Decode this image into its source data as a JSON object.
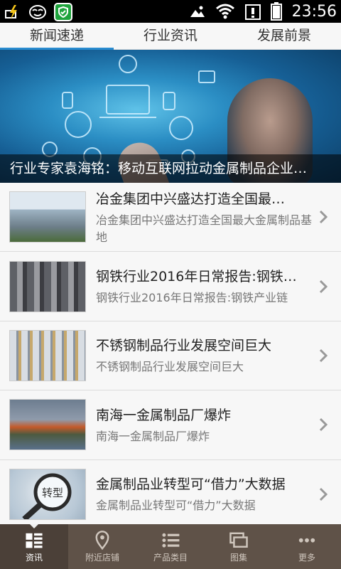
{
  "status_bar": {
    "time": "23:56",
    "icons": [
      "flash-icon",
      "face-icon",
      "shield-app-icon",
      "image-icon",
      "wifi-icon",
      "alert-icon",
      "battery-icon"
    ]
  },
  "tabs": [
    {
      "label": "新闻速递",
      "active": true
    },
    {
      "label": "行业资讯",
      "active": false
    },
    {
      "label": "发展前景",
      "active": false
    }
  ],
  "hero": {
    "caption": "行业专家袁海铭：移动互联网拉动金属制品企业…"
  },
  "news": [
    {
      "title": "冶金集团中兴盛达打造全国最…",
      "desc": "冶金集团中兴盛达打造全国最大金属制品基地"
    },
    {
      "title": "钢铁行业2016年日常报告:钢铁…",
      "desc": "钢铁行业2016年日常报告:钢铁产业链"
    },
    {
      "title": "不锈钢制品行业发展空间巨大",
      "desc": "不锈钢制品行业发展空间巨大"
    },
    {
      "title": "南海一金属制品厂爆炸",
      "desc": "南海一金属制品厂爆炸"
    },
    {
      "title": "金属制品业转型可“借力”大数据",
      "desc": "金属制品业转型可“借力”大数据"
    }
  ],
  "thumb5_text": "转型",
  "bottom_nav": [
    {
      "label": "资讯",
      "icon": "grid-news-icon",
      "active": true
    },
    {
      "label": "附近店铺",
      "icon": "location-pin-icon",
      "active": false
    },
    {
      "label": "产品类目",
      "icon": "list-icon",
      "active": false
    },
    {
      "label": "图集",
      "icon": "gallery-icon",
      "active": false
    },
    {
      "label": "更多",
      "icon": "more-dots-icon",
      "active": false
    }
  ]
}
